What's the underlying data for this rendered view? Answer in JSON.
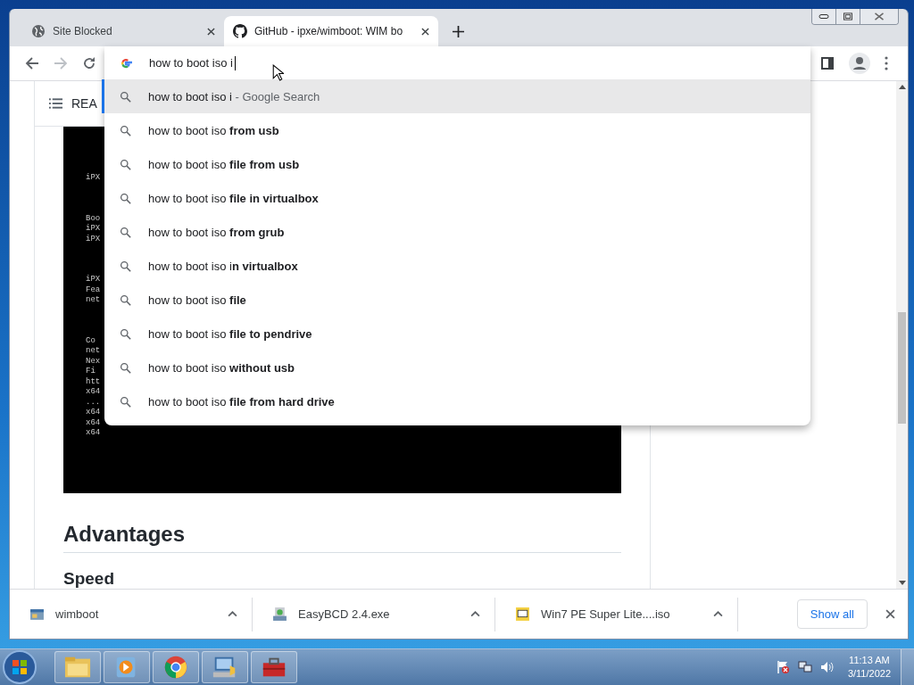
{
  "tabs": [
    {
      "title": "Site Blocked",
      "kind": "globe",
      "selected": false
    },
    {
      "title": "GitHub - ipxe/wimboot: WIM bo",
      "kind": "github",
      "selected": true
    }
  ],
  "omnibox": {
    "value": "how to boot iso i"
  },
  "suggestions": [
    {
      "kind": "typed",
      "text": "how to boot iso i",
      "suffix": " - Google Search",
      "selected": true
    },
    {
      "kind": "query",
      "text": "how to boot iso **from usb**",
      "selected": false
    },
    {
      "kind": "query",
      "text": "how to boot iso **file from usb**",
      "selected": false
    },
    {
      "kind": "query",
      "text": "how to boot iso **file in virtualbox**",
      "selected": false
    },
    {
      "kind": "query",
      "text": "how to boot iso **from grub**",
      "selected": false
    },
    {
      "kind": "query",
      "text": "how to boot iso i**n virtualbox**",
      "selected": false
    },
    {
      "kind": "query",
      "text": "how to boot iso **file**",
      "selected": false
    },
    {
      "kind": "query",
      "text": "how to boot iso **file to pendrive**",
      "selected": false
    },
    {
      "kind": "query",
      "text": "how to boot iso **without usb**",
      "selected": false
    },
    {
      "kind": "query",
      "text": "how to boot iso **file from hard drive**",
      "selected": false
    }
  ],
  "readme_header": "REA",
  "terminal_blocks": [
    [
      "iPX"
    ],
    [
      "Boo",
      "iPX",
      "iPX"
    ],
    [
      "iPX",
      "Fea",
      "net"
    ],
    [
      "Co",
      "net",
      "Nex",
      "Fi",
      "htt",
      "x64",
      "...",
      "x64",
      "x64",
      "x64"
    ]
  ],
  "heading": "Advantages",
  "subheading": "Speed",
  "downloads": [
    {
      "name": "wimboot",
      "kind": "program"
    },
    {
      "name": "EasyBCD 2.4.exe",
      "kind": "installer"
    },
    {
      "name": "Win7 PE Super Lite....iso",
      "kind": "iso"
    }
  ],
  "show_all": "Show all",
  "taskbar": [
    {
      "kind": "folder"
    },
    {
      "kind": "media"
    },
    {
      "kind": "chrome"
    },
    {
      "kind": "easybcd"
    },
    {
      "kind": "toolbox"
    }
  ],
  "clock": {
    "time": "11:13 AM",
    "date": "3/11/2022"
  }
}
